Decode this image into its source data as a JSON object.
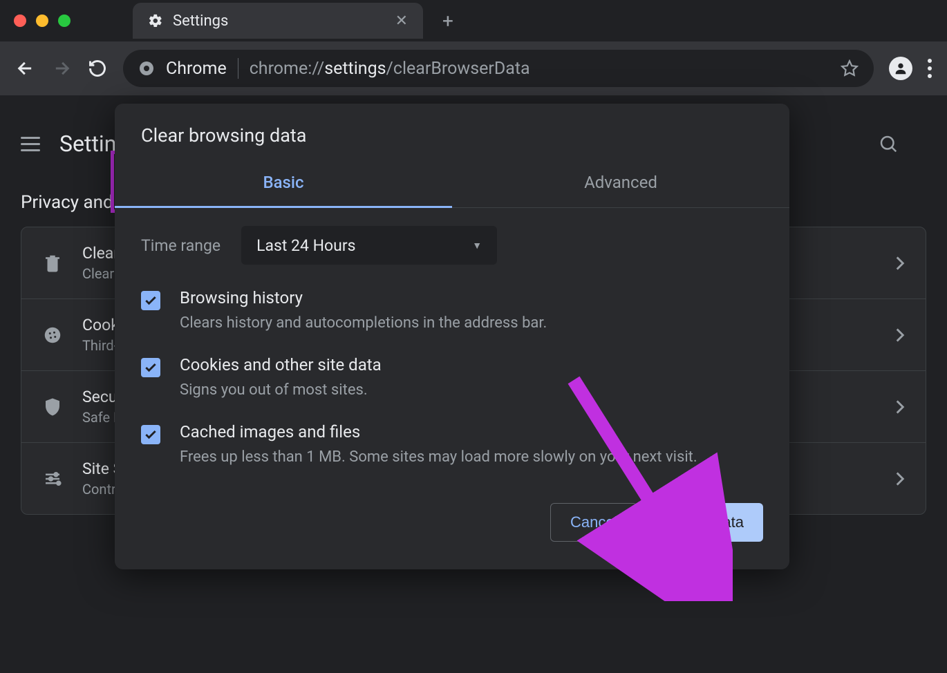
{
  "window": {
    "tab_title": "Settings",
    "url_prefix": "Chrome",
    "url_scheme": "chrome://",
    "url_bold": "settings",
    "url_rest": "/clearBrowserData"
  },
  "settings_page": {
    "title": "Settings",
    "section": "Privacy and security",
    "rows": [
      {
        "title": "Clear browsing data",
        "sub": "Clear history, cookies, cache, and more"
      },
      {
        "title": "Cookies and other site data",
        "sub": "Third-party cookies are blocked in Incognito mode"
      },
      {
        "title": "Security",
        "sub": "Safe Browsing (protection from dangerous sites) and other security settings"
      },
      {
        "title": "Site Settings",
        "sub": "Controls what information sites can use and show"
      }
    ]
  },
  "dialog": {
    "title": "Clear browsing data",
    "tabs": {
      "basic": "Basic",
      "advanced": "Advanced"
    },
    "time_label": "Time range",
    "time_value": "Last 24 Hours",
    "options": [
      {
        "title": "Browsing history",
        "sub": "Clears history and autocompletions in the address bar.",
        "checked": true
      },
      {
        "title": "Cookies and other site data",
        "sub": "Signs you out of most sites.",
        "checked": true
      },
      {
        "title": "Cached images and files",
        "sub": "Frees up less than 1 MB. Some sites may load more slowly on your next visit.",
        "checked": true
      }
    ],
    "cancel": "Cancel",
    "clear": "Clear data"
  }
}
